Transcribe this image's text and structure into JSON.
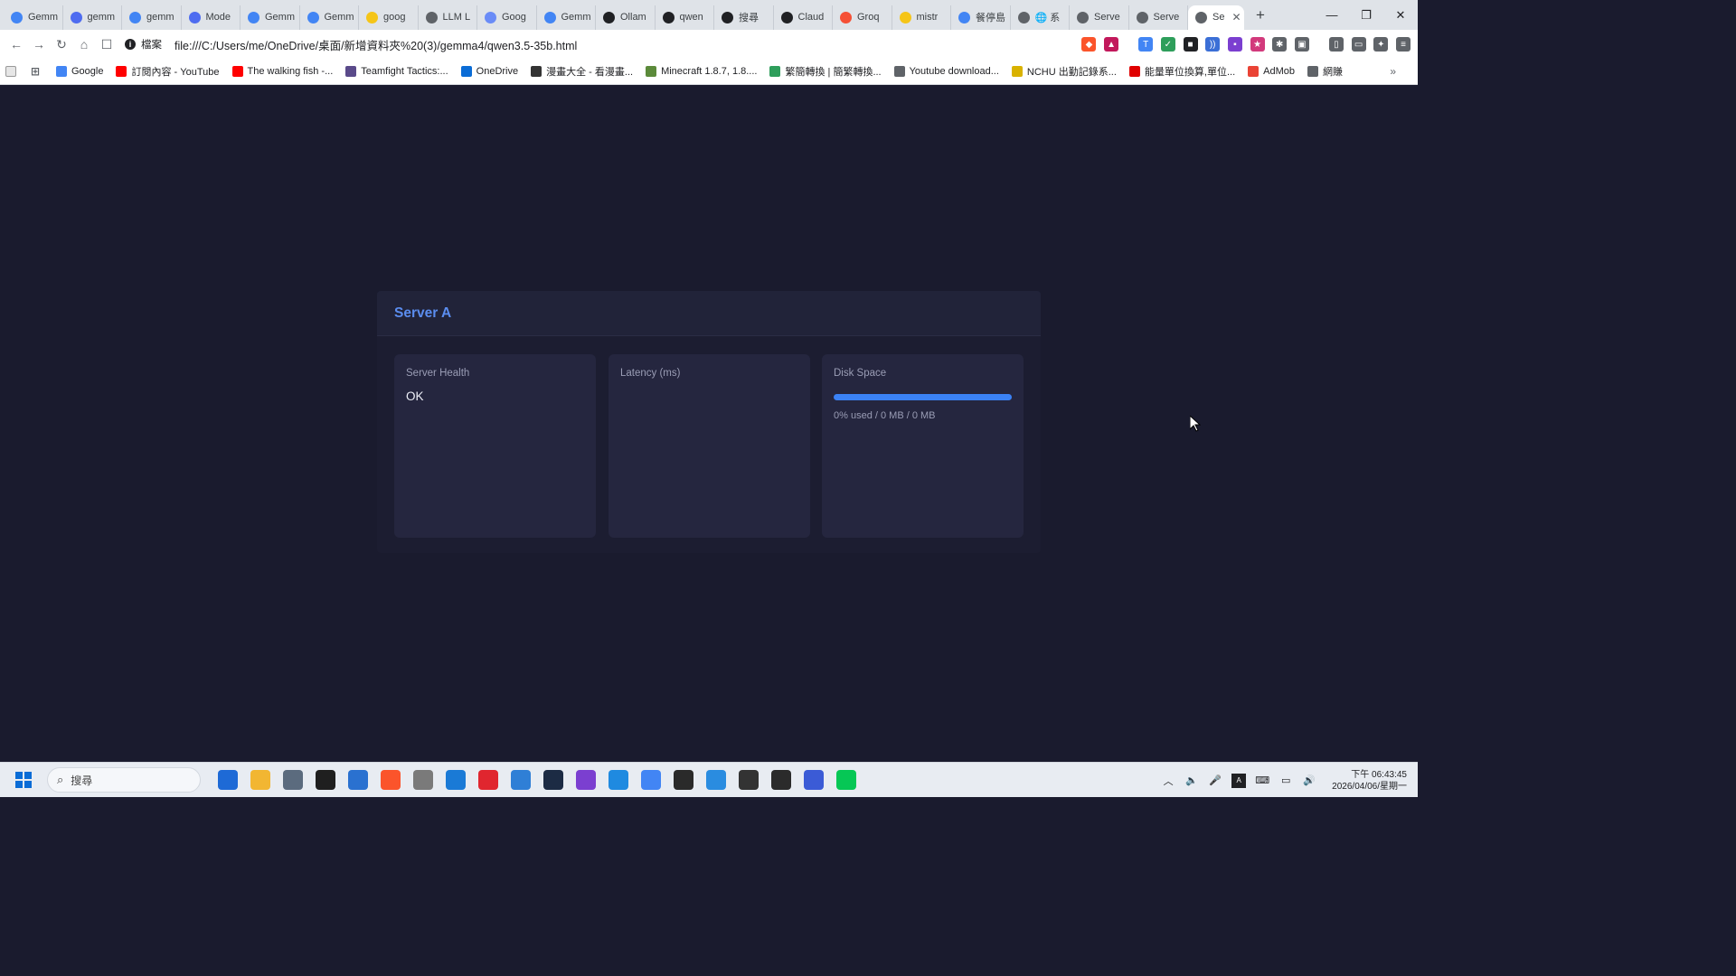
{
  "browser": {
    "tabs": [
      {
        "label": "Gemm",
        "icon": "google-icon",
        "color": "#4285f4"
      },
      {
        "label": "gemm",
        "icon": "google-ai-icon",
        "color": "#4e6cf0"
      },
      {
        "label": "gemm",
        "icon": "google-icon",
        "color": "#4285f4"
      },
      {
        "label": "Mode",
        "icon": "google-ai-icon",
        "color": "#4e6cf0"
      },
      {
        "label": "Gemm",
        "icon": "google-icon",
        "color": "#4285f4"
      },
      {
        "label": "Gemm",
        "icon": "google-icon",
        "color": "#4285f4"
      },
      {
        "label": "goog",
        "icon": "hugging-face-icon",
        "color": "#f5c518"
      },
      {
        "label": "LLM L",
        "icon": "arena-icon",
        "color": "#5f6368"
      },
      {
        "label": "Goog",
        "icon": "gemini-icon",
        "color": "#6a8cf7"
      },
      {
        "label": "Gemm",
        "icon": "google-icon",
        "color": "#4285f4"
      },
      {
        "label": "Ollam",
        "icon": "ollama-icon",
        "color": "#202124"
      },
      {
        "label": "qwen",
        "icon": "ollama-icon",
        "color": "#202124"
      },
      {
        "label": "搜尋",
        "icon": "tw-icon",
        "color": "#202124"
      },
      {
        "label": "Claud",
        "icon": "tw-icon",
        "color": "#202124"
      },
      {
        "label": "Groq",
        "icon": "groq-icon",
        "color": "#f55036"
      },
      {
        "label": "mistr",
        "icon": "hugging-face-icon",
        "color": "#f5c518"
      },
      {
        "label": "餐停島",
        "icon": "google-icon",
        "color": "#4285f4"
      },
      {
        "label": "🌐 系",
        "icon": "globe-icon",
        "color": "#5f6368"
      },
      {
        "label": "Serve",
        "icon": "globe-icon",
        "color": "#5f6368"
      },
      {
        "label": "Serve",
        "icon": "globe-icon",
        "color": "#5f6368"
      }
    ],
    "active_tab": {
      "label": "Se",
      "icon": "globe-icon",
      "close": "✕"
    },
    "new_tab": "+",
    "window_controls": {
      "minimize": "—",
      "maximize": "❐",
      "close": "✕"
    },
    "address": {
      "scheme_label": "檔案",
      "url": "file:///C:/Users/me/OneDrive/桌面/新增資料夾%20(3)/gemma4/qwen3.5-35b.html"
    },
    "bookmarks": [
      {
        "label": "Google",
        "icon": "google-icon",
        "color": "#4285f4"
      },
      {
        "label": "訂閱內容 - YouTube",
        "icon": "youtube-icon",
        "color": "#ff0000"
      },
      {
        "label": "The walking fish -...",
        "icon": "youtube-icon",
        "color": "#ff0000"
      },
      {
        "label": "Teamfight Tactics:...",
        "icon": "tft-icon",
        "color": "#5a4a8a"
      },
      {
        "label": "OneDrive",
        "icon": "onedrive-icon",
        "color": "#0a6cd6"
      },
      {
        "label": "漫畫大全 - 看漫畫...",
        "icon": "manga-icon",
        "color": "#333333"
      },
      {
        "label": "Minecraft 1.8.7, 1.8....",
        "icon": "minecraft-icon",
        "color": "#5b8a3a"
      },
      {
        "label": "繁簡轉換 | 簡繁轉換...",
        "icon": "convert-icon",
        "color": "#2e9e5b"
      },
      {
        "label": "Youtube download...",
        "icon": "globe-icon",
        "color": "#5f6368"
      },
      {
        "label": "NCHU 出勤記錄系...",
        "icon": "nchu-icon",
        "color": "#d9b200"
      },
      {
        "label": "能量單位換算,單位...",
        "icon": "energy-icon",
        "color": "#e00000"
      },
      {
        "label": "AdMob",
        "icon": "admob-icon",
        "color": "#ea4335"
      },
      {
        "label": "網賺",
        "icon": "folder-icon",
        "color": "#5f6368"
      }
    ]
  },
  "dashboard": {
    "title": "Server A",
    "widgets": {
      "health": {
        "title": "Server Health",
        "value": "OK"
      },
      "latency": {
        "title": "Latency (ms)"
      },
      "disk": {
        "title": "Disk Space",
        "summary": "0% used / 0 MB / 0 MB",
        "used_fraction": 0
      }
    },
    "accent_color": "#5b8def",
    "bar_color": "#3b82f6"
  },
  "taskbar": {
    "search_placeholder": "搜尋",
    "apps": [
      {
        "name": "store-icon",
        "color": "#1e6ad6"
      },
      {
        "name": "file-explorer-icon",
        "color": "#f2b632"
      },
      {
        "name": "calculator-icon",
        "color": "#5b6b7e"
      },
      {
        "name": "media-icon",
        "color": "#1f1f1f"
      },
      {
        "name": "word-icon",
        "color": "#2a71d0"
      },
      {
        "name": "brave-icon",
        "color": "#fb542b"
      },
      {
        "name": "compass-icon",
        "color": "#7a7a7a"
      },
      {
        "name": "photo-icon",
        "color": "#1a7ad6"
      },
      {
        "name": "app-red-icon",
        "color": "#e0262f"
      },
      {
        "name": "notepad-icon",
        "color": "#2f7fd6"
      },
      {
        "name": "font-icon",
        "color": "#1c2b44"
      },
      {
        "name": "obsidian-icon",
        "color": "#7b3fd0"
      },
      {
        "name": "vscode-icon",
        "color": "#1f8ae0"
      },
      {
        "name": "chrome-icon",
        "color": "#4285f4"
      },
      {
        "name": "obs-icon",
        "color": "#2a2a2a"
      },
      {
        "name": "paint-icon",
        "color": "#2a8ce0"
      },
      {
        "name": "ollama-icon",
        "color": "#333333"
      },
      {
        "name": "terminal-icon",
        "color": "#2b2b2b"
      },
      {
        "name": "headset-icon",
        "color": "#3b5bd6"
      },
      {
        "name": "line-icon",
        "color": "#06c755"
      }
    ],
    "clock_time": "下午 06:43:45",
    "clock_date": "2026/04/06/星期一"
  }
}
